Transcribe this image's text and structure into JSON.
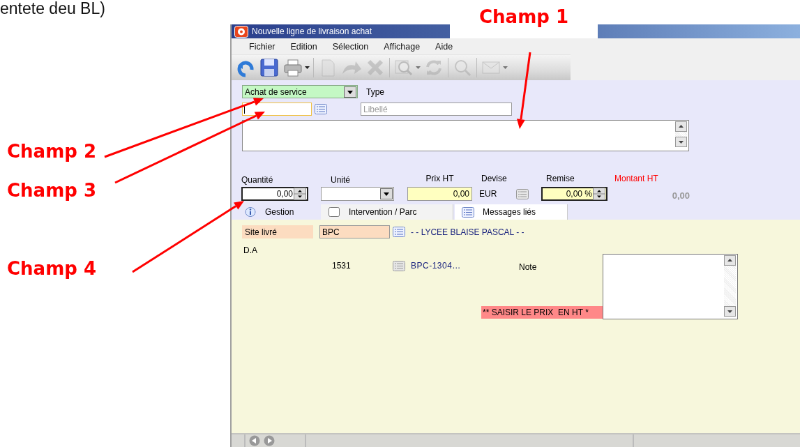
{
  "document_text": "entete deu BL)",
  "annotations": [
    {
      "label": "Champ 1"
    },
    {
      "label": "Champ 2"
    },
    {
      "label": "Champ 3"
    },
    {
      "label": "Champ 4"
    }
  ],
  "window": {
    "title": "Nouvelle ligne de livraison achat"
  },
  "menu": [
    "Fichier",
    "Edition",
    "Sélection",
    "Affichage",
    "Aide"
  ],
  "toolbar": [
    {
      "kind": "undo",
      "disabled": false,
      "dropdown": false
    },
    {
      "kind": "save",
      "disabled": false,
      "dropdown": false
    },
    {
      "kind": "print",
      "disabled": false,
      "dropdown": true
    },
    {
      "kind": "document",
      "disabled": true,
      "dropdown": false
    },
    {
      "kind": "forward",
      "disabled": true,
      "dropdown": false
    },
    {
      "kind": "delete",
      "disabled": true,
      "dropdown": false
    },
    {
      "kind": "zoom",
      "disabled": true,
      "dropdown": true
    },
    {
      "kind": "refresh",
      "disabled": true,
      "dropdown": false
    },
    {
      "kind": "search",
      "disabled": true,
      "dropdown": false
    },
    {
      "kind": "mail",
      "disabled": true,
      "dropdown": true
    }
  ],
  "header": {
    "purchase_type": {
      "value": "Achat de service"
    },
    "type_label": "Type",
    "code_field": {
      "focused": true
    },
    "label_field": {
      "placeholder": "Libellé"
    }
  },
  "line": {
    "quantity": {
      "label": "Quantité",
      "value": "0,00"
    },
    "unit": {
      "label": "Unité"
    },
    "price": {
      "label": "Prix HT",
      "value": "0,00"
    },
    "currency": {
      "label": "Devise",
      "value": "EUR"
    },
    "discount": {
      "label": "Remise",
      "value": "0,00 %"
    },
    "amount": {
      "label": "Montant HT",
      "value": "0,00"
    }
  },
  "tabs": [
    {
      "label": "Gestion",
      "selected": true
    },
    {
      "label": "Intervention / Parc",
      "selected": false
    },
    {
      "label": "Messages liés",
      "selected": false
    }
  ],
  "gestion": {
    "site": {
      "label": "Site livré",
      "value": "BPC",
      "name": "- - LYCEE BLAISE PASCAL - -"
    },
    "da": {
      "label": "D.A",
      "number": "1531",
      "reference": "BPC-1304…"
    },
    "note": {
      "label": "Note"
    },
    "warning": "** SAISIR LE PRIX  EN HT *"
  }
}
